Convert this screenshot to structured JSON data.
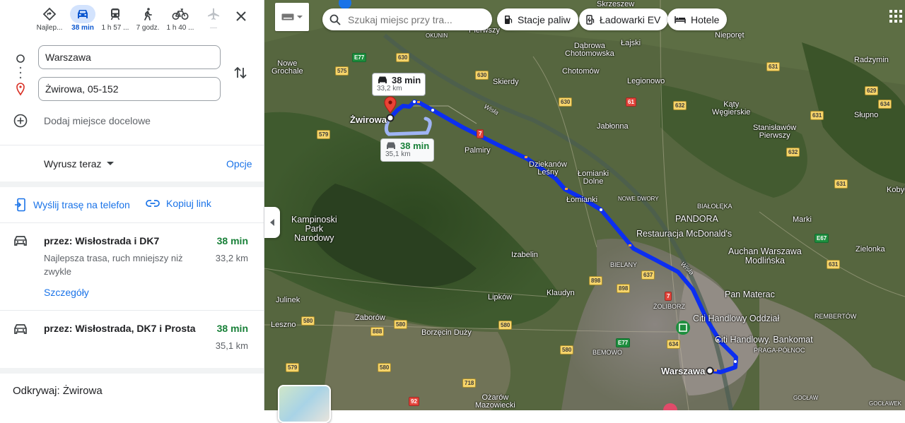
{
  "travel_modes": [
    {
      "icon": "best-route-icon",
      "label": "Najlep..."
    },
    {
      "icon": "car-icon",
      "label": "38 min"
    },
    {
      "icon": "train-icon",
      "label": "1 h 57 ..."
    },
    {
      "icon": "walk-icon",
      "label": "7 godz."
    },
    {
      "icon": "bicycle-icon",
      "label": "1 h 40 ..."
    },
    {
      "icon": "flight-icon",
      "label": "—"
    }
  ],
  "inputs": {
    "origin": "Warszawa",
    "destination": "Żwirowa, 05-152",
    "add_destination": "Dodaj miejsce docelowe"
  },
  "departure": {
    "label": "Wyrusz teraz",
    "options_label": "Opcje"
  },
  "actions": {
    "send_to_phone": "Wyślij trasę na telefon",
    "copy_link": "Kopiuj link"
  },
  "routes": [
    {
      "title": "przez: Wisłostrada i DK7",
      "time": "38 min",
      "distance": "33,2 km",
      "description": "Najlepsza trasa, ruch mniejszy niż zwykle",
      "details_link": "Szczegóły"
    },
    {
      "title": "przez: Wisłostrada, DK7 i Prosta",
      "time": "38 min",
      "distance": "35,1 km"
    }
  ],
  "explore": "Odkrywaj: Żwirowa",
  "map": {
    "search_placeholder": "Szukaj miejsc przy tra...",
    "chips": [
      "Stacje paliw",
      "Ładowarki EV",
      "Hotele"
    ],
    "callouts": [
      {
        "time": "38 min",
        "distance": "33,2 km"
      },
      {
        "time": "38 min",
        "distance": "35,1 km"
      }
    ],
    "labels": {
      "zwirowa": "Żwirowa",
      "warszawa": "Warszawa",
      "kampinoski": "Kampinoski\nPark\nNarodowy",
      "pandora": "PANDORA",
      "mcd": "Restauracja McDonald's",
      "auchan": "Auchan Warszawa\nModlińska",
      "panmaterac": "Pan Materac",
      "citi1": "Citi Handlowy Oddział",
      "citi2": "Citi Handlowy. Bankomat",
      "palmiry": "Palmiry",
      "dziekanow": "Dziekanów\nLeśny",
      "lomianki": "Łomianki",
      "lomiankidolne": "Łomianki\nDolne",
      "izabelin": "Izabelin",
      "lipkow": "Lipków",
      "klaudyn": "Klaudyn",
      "julinek": "Julinek",
      "leszno": "Leszno",
      "zaborow": "Zaborów",
      "borzecin": "Borzęcin Duży",
      "ozarow": "Ożarów\nMazowiecki",
      "bemowo": "BEMOWO",
      "bielany": "BIELANY",
      "zoliborz": "ŻOLIBORZ",
      "pragapolnoc": "PRAGA-PÓŁNOC",
      "bialoleka": "BIAŁOŁĘKA",
      "marki": "Marki",
      "zielonka": "Zielonka",
      "rembertow": "REMBERTÓW",
      "kobylka": "Kobyłk",
      "slupno": "Słupno",
      "katy": "Kąty\nWęgierskie",
      "stanislawow": "Stanisławów\nPierwszy",
      "jablonna": "Jabłonna",
      "legionowo": "Legionowo",
      "chotomow": "Chotomów",
      "dabrowa": "Dąbrowa\nChotomowska",
      "skierdy": "Skierdy",
      "nowedwory": "NOWE DWORY",
      "nowegrochale": "Nowe\nGrochale",
      "okunin": "OKUNIN",
      "pierwszy": "Pierwszy",
      "niepoiet": "Nieporęt",
      "lajski": "Łajski",
      "radzymin": "Radzymin",
      "rzeszce": "Skrzeszew",
      "gocław": "GOCŁAW",
      "goclawek": "GOCŁAWEK",
      "wisla": "Wisła"
    },
    "road_badges": [
      "630",
      "630",
      "630",
      "575",
      "579",
      "7",
      "632",
      "631",
      "629",
      "631",
      "632",
      "631",
      "634",
      "631",
      "898",
      "898",
      "637",
      "7",
      "580",
      "580",
      "888",
      "580",
      "580",
      "580",
      "579",
      "718",
      "92",
      "634",
      "E77",
      "E77",
      "E67",
      "61"
    ]
  }
}
